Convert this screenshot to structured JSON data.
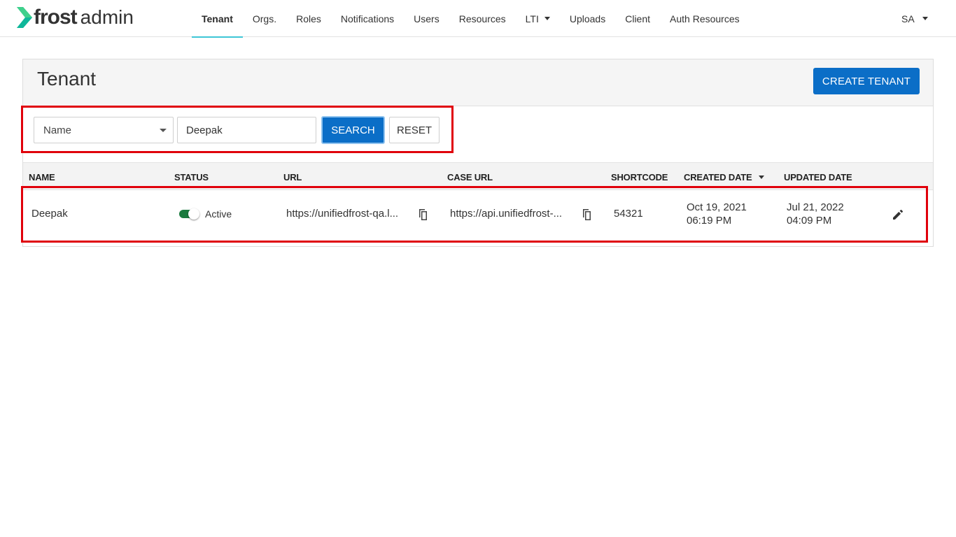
{
  "app": {
    "logo_brand": "frost",
    "logo_suffix": "admin",
    "accent_color": "#3ec6d6",
    "primary_color": "#0b6ec7",
    "highlight_color": "#e0000b"
  },
  "nav": {
    "items": [
      {
        "label": "Tenant",
        "active": true
      },
      {
        "label": "Orgs.",
        "active": false
      },
      {
        "label": "Roles",
        "active": false
      },
      {
        "label": "Notifications",
        "active": false
      },
      {
        "label": "Users",
        "active": false
      },
      {
        "label": "Resources",
        "active": false
      },
      {
        "label": "LTI",
        "active": false,
        "dropdown": true
      },
      {
        "label": "Uploads",
        "active": false
      },
      {
        "label": "Client",
        "active": false
      },
      {
        "label": "Auth Resources",
        "active": false
      }
    ],
    "user_initials": "SA"
  },
  "page": {
    "title": "Tenant",
    "create_label": "CREATE TENANT"
  },
  "search": {
    "field_selected": "Name",
    "query_value": "Deepak",
    "search_label": "SEARCH",
    "reset_label": "RESET"
  },
  "table": {
    "columns": [
      "NAME",
      "STATUS",
      "URL",
      "CASE URL",
      "SHORTCODE",
      "CREATED DATE",
      "UPDATED DATE"
    ],
    "sorted_column": "CREATED DATE",
    "rows": [
      {
        "name": "Deepak",
        "status": "Active",
        "status_on": true,
        "url": "https://unifiedfrost-qa.l...",
        "case_url": "https://api.unifiedfrost-...",
        "shortcode": "54321",
        "created_date": "Oct 19, 2021",
        "created_time": "06:19 PM",
        "updated_date": "Jul 21, 2022",
        "updated_time": "04:09 PM"
      }
    ]
  },
  "icons": {
    "logo": "chevron-right-icon",
    "copy": "copy-icon",
    "edit": "pencil-icon",
    "caret": "caret-down-icon"
  }
}
